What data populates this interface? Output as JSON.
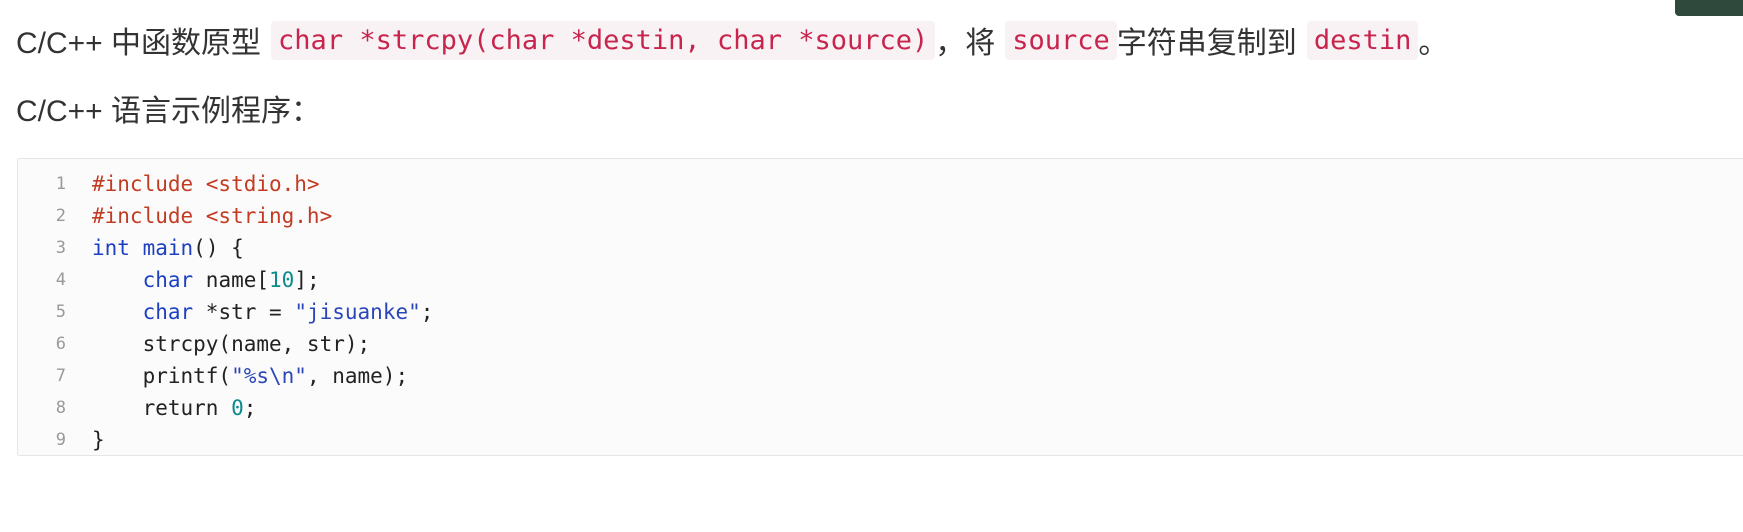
{
  "intro": {
    "prefix": "C/C++ 中函数原型",
    "prototype": "char *strcpy(char *destin, char *source)",
    "middle": "，将",
    "param_source": "source",
    "middle2": "字符串复制到",
    "param_destin": "destin",
    "suffix": "。"
  },
  "subheading": "C/C++ 语言示例程序：",
  "code": {
    "line_numbers": [
      "1",
      "2",
      "3",
      "4",
      "5",
      "6",
      "7",
      "8",
      "9"
    ],
    "lines": [
      [
        {
          "t": "#include <stdio.h>",
          "c": "pp"
        }
      ],
      [
        {
          "t": "#include <string.h>",
          "c": "pp"
        }
      ],
      [
        {
          "t": "int",
          "c": "kw"
        },
        {
          "t": " ",
          "c": "pl"
        },
        {
          "t": "main",
          "c": "kw"
        },
        {
          "t": "() {",
          "c": "pl"
        }
      ],
      [
        {
          "t": "    ",
          "c": "pl"
        },
        {
          "t": "char",
          "c": "kw"
        },
        {
          "t": " name[",
          "c": "pl"
        },
        {
          "t": "10",
          "c": "num"
        },
        {
          "t": "];",
          "c": "pl"
        }
      ],
      [
        {
          "t": "    ",
          "c": "pl"
        },
        {
          "t": "char",
          "c": "kw"
        },
        {
          "t": " *str = ",
          "c": "pl"
        },
        {
          "t": "\"jisuanke\"",
          "c": "str"
        },
        {
          "t": ";",
          "c": "pl"
        }
      ],
      [
        {
          "t": "    strcpy(name, str);",
          "c": "pl"
        }
      ],
      [
        {
          "t": "    printf(",
          "c": "pl"
        },
        {
          "t": "\"%s\\n\"",
          "c": "str"
        },
        {
          "t": ", name);",
          "c": "pl"
        }
      ],
      [
        {
          "t": "    return ",
          "c": "pl"
        },
        {
          "t": "0",
          "c": "num"
        },
        {
          "t": ";",
          "c": "pl"
        }
      ],
      [
        {
          "t": "}",
          "c": "pl"
        }
      ]
    ]
  },
  "colors": {
    "inline_code": "#c7254e",
    "inline_code_bg": "#f9f2f4",
    "preprocessor": "#c23b22",
    "keyword": "#1d3fc1",
    "string": "#2a46b8",
    "number": "#0b8b8b",
    "line_number": "#999999"
  }
}
